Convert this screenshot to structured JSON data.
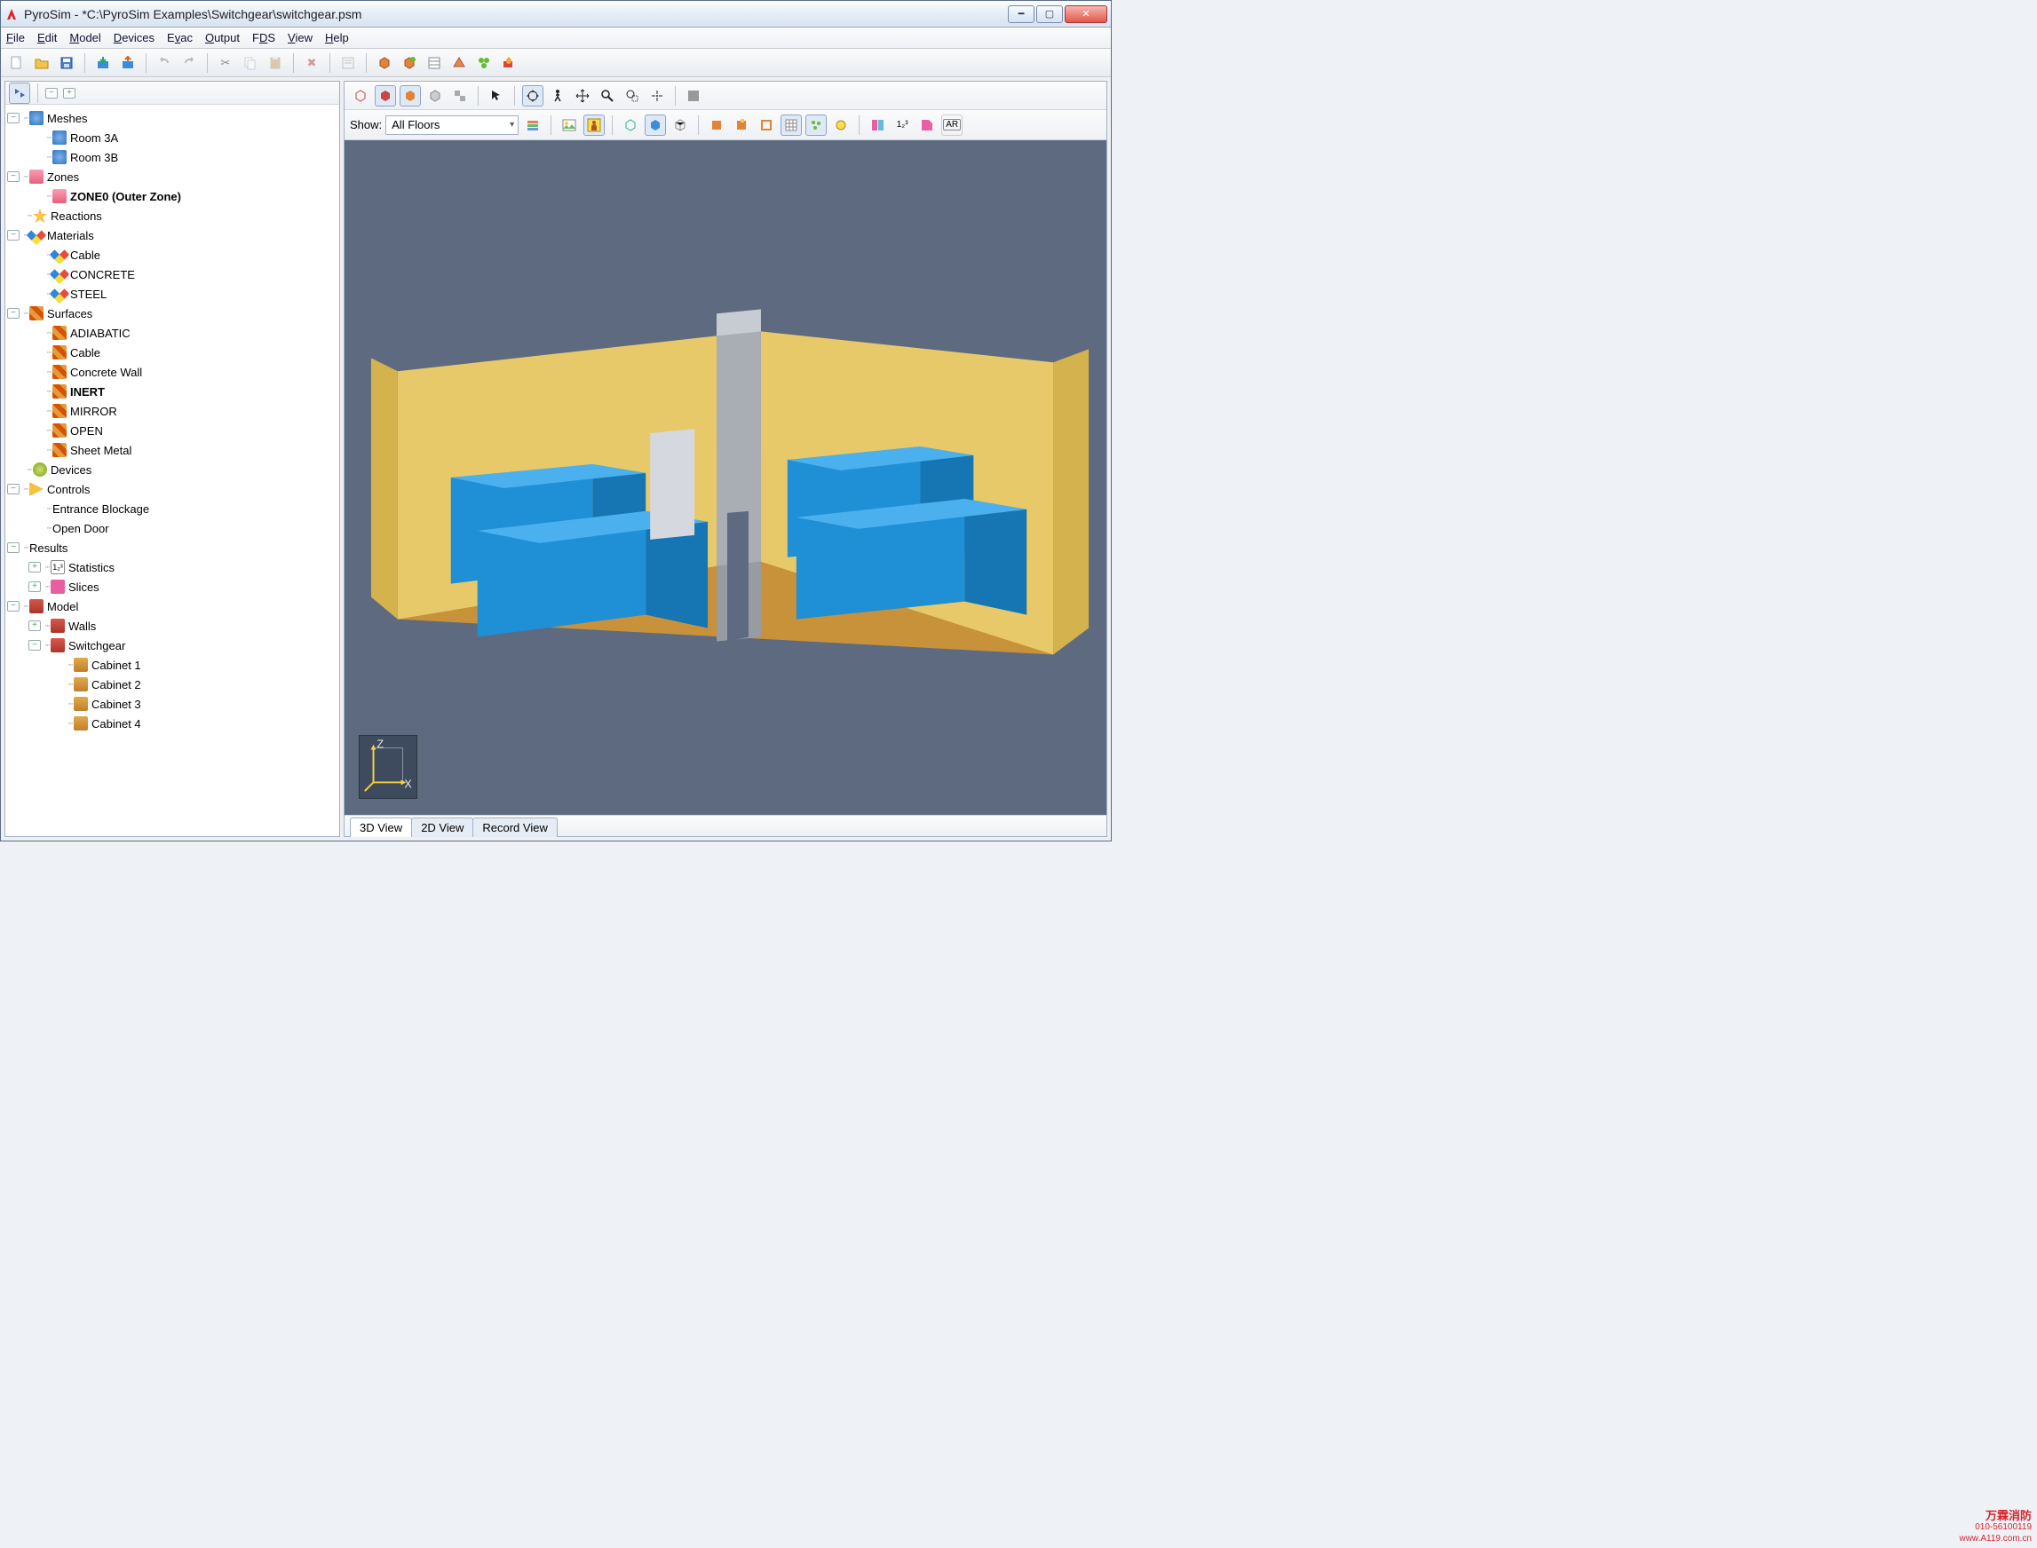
{
  "title": "PyroSim - *C:\\PyroSim Examples\\Switchgear\\switchgear.psm",
  "menu": [
    "File",
    "Edit",
    "Model",
    "Devices",
    "Evac",
    "Output",
    "FDS",
    "View",
    "Help"
  ],
  "show_label": "Show:",
  "show_value": "All Floors",
  "tabs": {
    "t3d": "3D View",
    "t2d": "2D View",
    "trec": "Record View"
  },
  "axes": {
    "x": "X",
    "z": "Z"
  },
  "tree": {
    "meshes": "Meshes",
    "room3a": "Room 3A",
    "room3b": "Room 3B",
    "zones": "Zones",
    "zone0": "ZONE0 (Outer Zone)",
    "reactions": "Reactions",
    "materials": "Materials",
    "m_cable": "Cable",
    "m_concrete": "CONCRETE",
    "m_steel": "STEEL",
    "surfaces": "Surfaces",
    "s_adiabatic": "ADIABATIC",
    "s_cable": "Cable",
    "s_concrete_wall": "Concrete Wall",
    "s_inert": "INERT",
    "s_mirror": "MIRROR",
    "s_open": "OPEN",
    "s_sheet_metal": "Sheet Metal",
    "devices": "Devices",
    "controls": "Controls",
    "c_entrance": "Entrance Blockage",
    "c_open_door": "Open Door",
    "results": "Results",
    "r_statistics": "Statistics",
    "r_slices": "Slices",
    "model": "Model",
    "m_walls": "Walls",
    "m_switchgear": "Switchgear",
    "cab1": "Cabinet 1",
    "cab2": "Cabinet 2",
    "cab3": "Cabinet 3",
    "cab4": "Cabinet 4"
  },
  "watermark": {
    "l1": "万霖消防",
    "l2": "010-56100119",
    "l3": "www.A119.com.cn"
  }
}
